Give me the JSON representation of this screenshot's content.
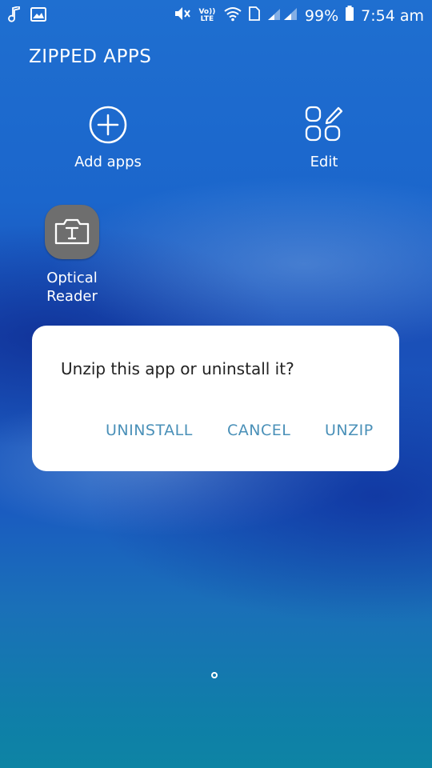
{
  "status_bar": {
    "volte_label": "Vo)) LTE",
    "battery": "99%",
    "time": "7:54 am",
    "icons": [
      "music-note-icon",
      "image-icon",
      "mute-icon",
      "volte-icon",
      "wifi-icon",
      "signal-icon",
      "battery-icon"
    ]
  },
  "folder": {
    "title": "ZIPPED APPS",
    "actions": [
      {
        "label": "Add apps",
        "icon": "add-circle-icon"
      },
      {
        "label": "Edit",
        "icon": "edit-grid-icon"
      }
    ],
    "apps": [
      {
        "label_line1": "Optical",
        "label_line2": "Reader",
        "icon": "camera-text-icon"
      }
    ]
  },
  "dialog": {
    "message": "Unzip this app or uninstall it?",
    "buttons": {
      "uninstall": "UNINSTALL",
      "cancel": "CANCEL",
      "unzip": "UNZIP"
    },
    "button_color": "#4a90b8"
  },
  "page_indicator": {
    "pages": 1,
    "current": 1
  }
}
